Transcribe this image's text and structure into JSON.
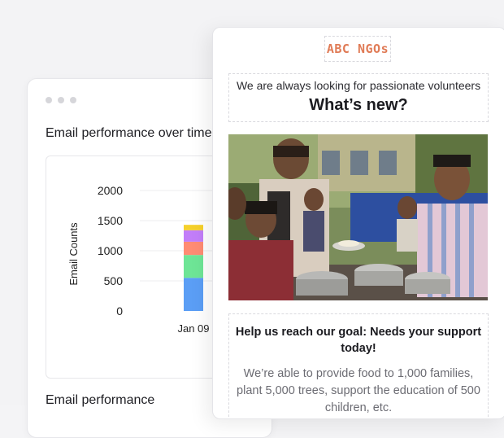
{
  "analytics": {
    "title": "Email performance over time",
    "subtitle": "Email performance"
  },
  "email": {
    "logo": "ABC NGOs",
    "tagline": "We are always looking for passionate volunteers",
    "headline": "What’s new?",
    "photo_alt": "Volunteer serving food to children",
    "goal_title": "Help us reach our goal: Needs your support today!",
    "goal_body": "We’re able to provide food to 1,000 families, plant 5,000 trees, support the education of 500 children, etc."
  },
  "chart_data": {
    "type": "bar",
    "categories": [
      "Jan 09"
    ],
    "ylabel": "Email Counts",
    "ylim": [
      0,
      2000
    ],
    "yticks": [
      "0",
      "500",
      "1000",
      "1500",
      "2000"
    ],
    "series": [
      {
        "values": [
          550
        ],
        "color": "#5b9ef5"
      },
      {
        "values": [
          380
        ],
        "color": "#6ee596"
      },
      {
        "values": [
          220
        ],
        "color": "#ff8c73"
      },
      {
        "values": [
          190
        ],
        "color": "#c27ef9"
      },
      {
        "values": [
          90
        ],
        "color": "#f5d02b"
      }
    ]
  }
}
